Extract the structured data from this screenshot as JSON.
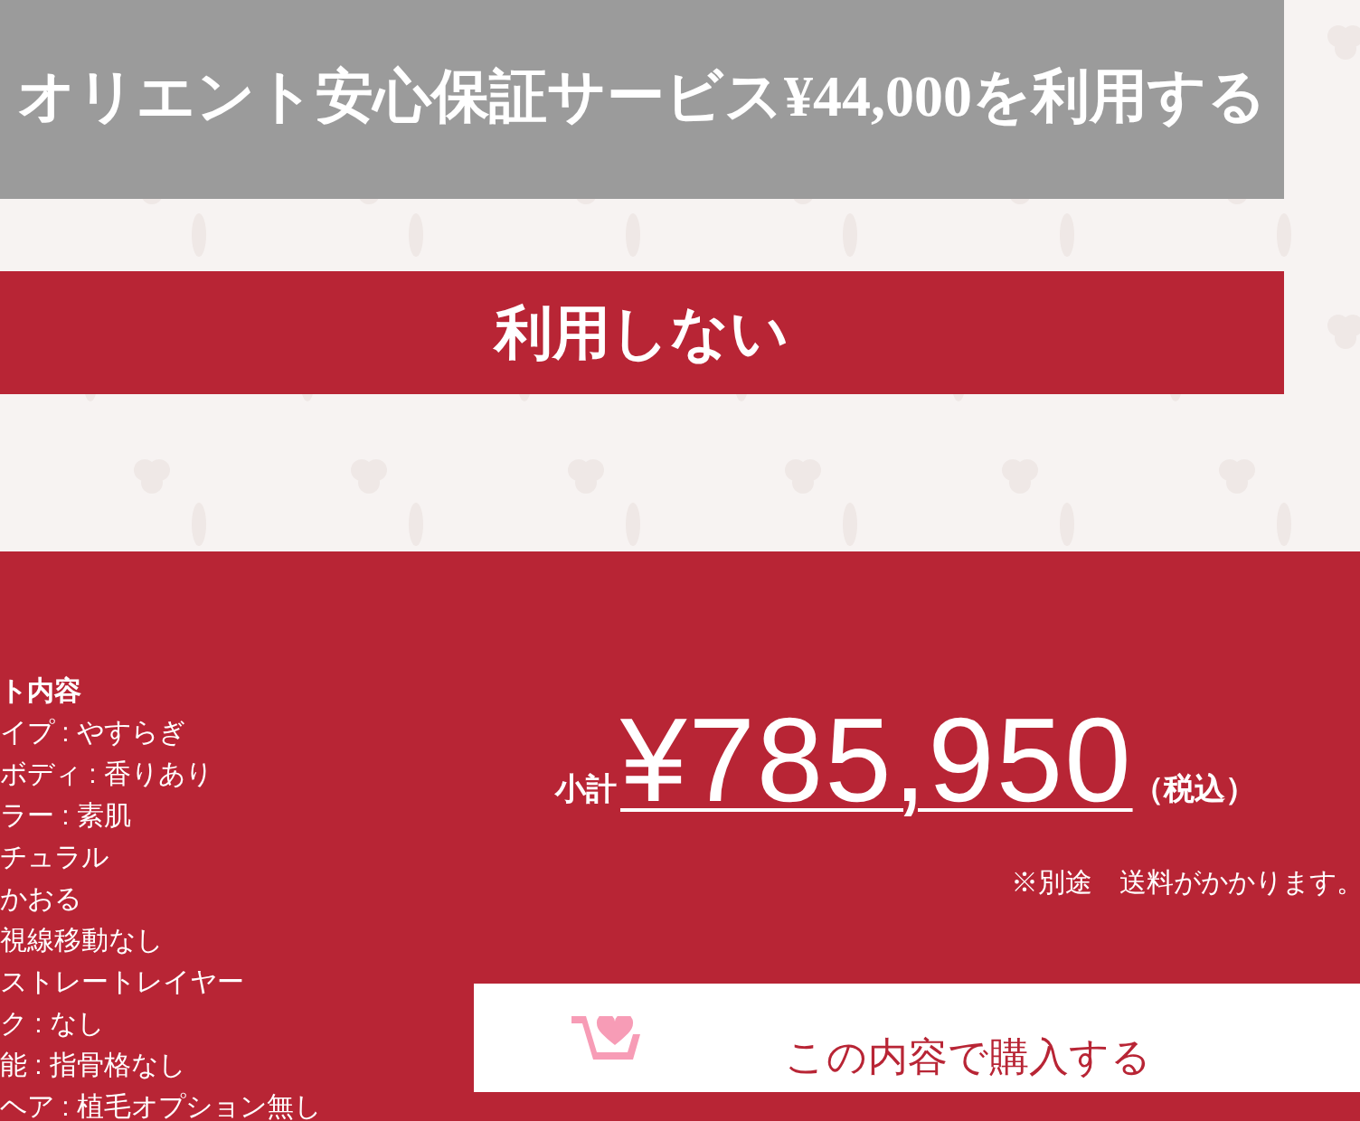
{
  "options": [
    {
      "label": "オリエント安心保証サービス¥44,000を利用する",
      "selected": false
    },
    {
      "label": "利用しない",
      "selected": true
    }
  ],
  "summary": {
    "items": [
      "ト内容",
      "イプ : やすらぎ",
      "ボディ : 香りあり",
      "ラー : 素肌",
      "チュラル",
      "かおる",
      "視線移動なし",
      "ストレートレイヤー",
      "ク : なし",
      "能 : 指骨格なし",
      "ヘア : 植毛オプション無し"
    ],
    "subtotal_label": "小計",
    "subtotal": "¥785,950",
    "tax_note": "（税込）",
    "shipping_note": "※別途　送料がかかります。"
  },
  "purchase_button": {
    "label": "この内容で購入する"
  }
}
